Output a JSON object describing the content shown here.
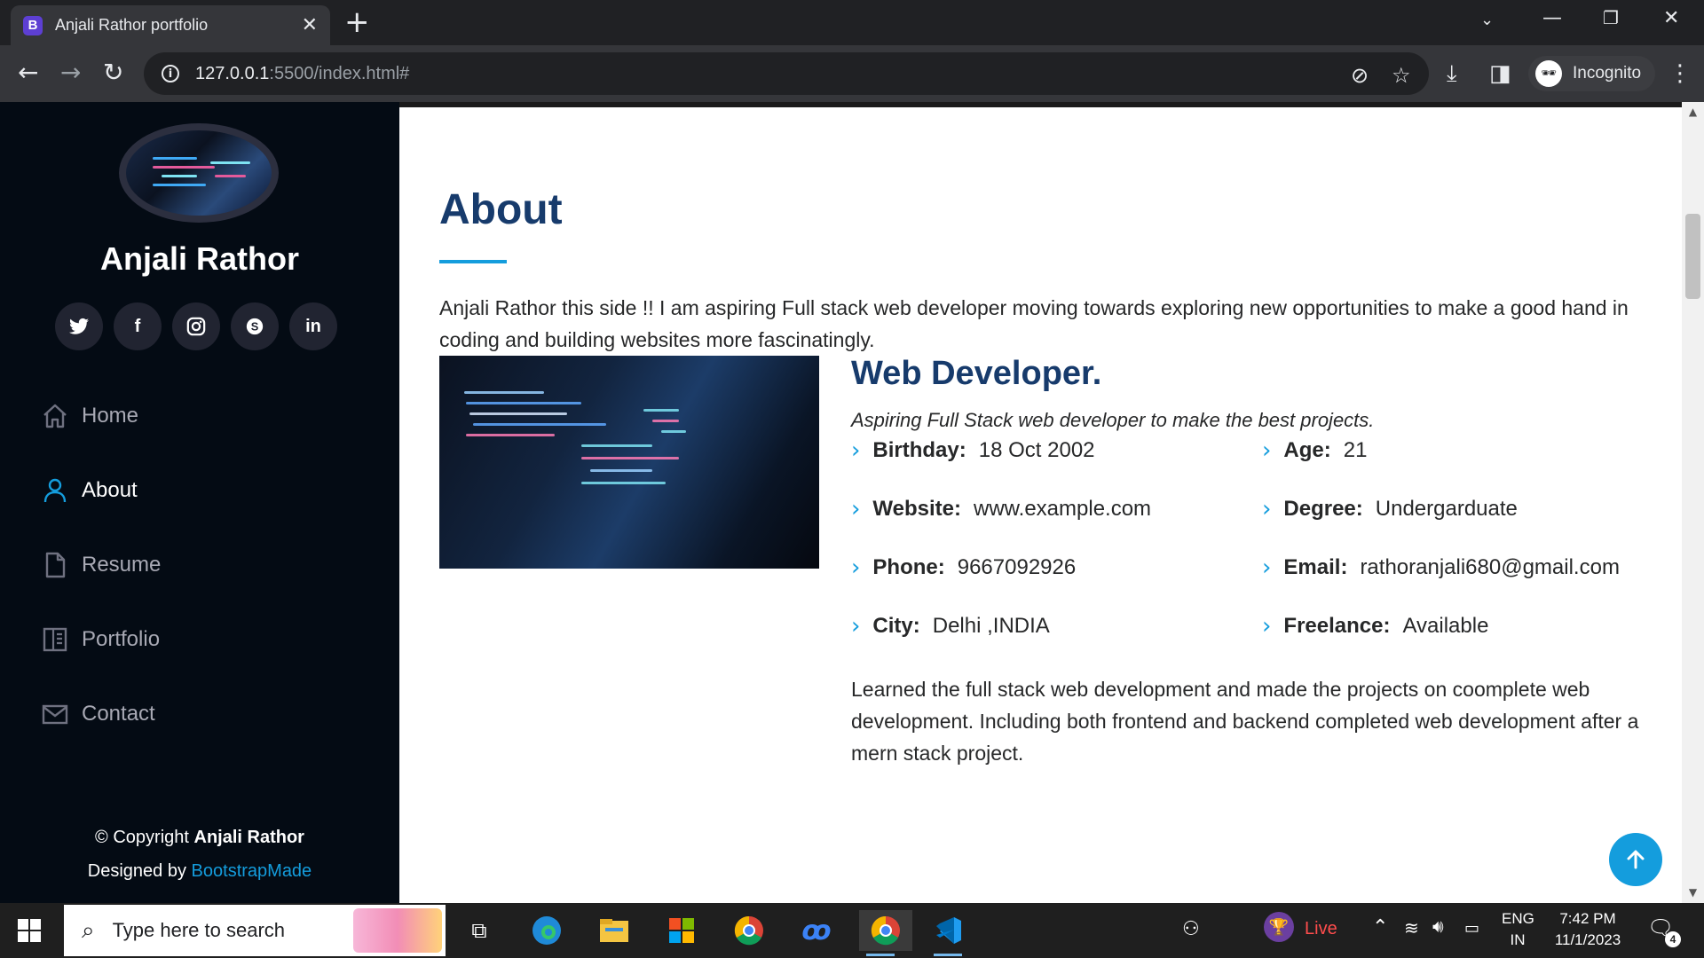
{
  "browser": {
    "tab_title": "Anjali Rathor portfolio",
    "favicon_letter": "B",
    "url_host": "127.0.0.1",
    "url_rest": ":5500/index.html#",
    "incognito_label": "Incognito"
  },
  "sidebar": {
    "name": "Anjali Rathor",
    "social": [
      {
        "icon": "twitter-icon",
        "glyph": "🐦"
      },
      {
        "icon": "facebook-icon",
        "glyph": "f"
      },
      {
        "icon": "instagram-icon",
        "glyph": "◎"
      },
      {
        "icon": "skype-icon",
        "glyph": "S"
      },
      {
        "icon": "linkedin-icon",
        "glyph": "in"
      }
    ],
    "nav": [
      {
        "label": "Home",
        "icon": "home-icon"
      },
      {
        "label": "About",
        "icon": "user-icon",
        "active": true
      },
      {
        "label": "Resume",
        "icon": "file-icon"
      },
      {
        "label": "Portfolio",
        "icon": "book-icon"
      },
      {
        "label": "Contact",
        "icon": "envelope-icon"
      }
    ],
    "footer": {
      "copyright_prefix": "© Copyright ",
      "copyright_name": "Anjali Rathor",
      "designed_prefix": "Designed by ",
      "designed_link": "BootstrapMade"
    }
  },
  "about": {
    "title": "About",
    "intro": "Anjali Rathor this side !! I am aspiring Full stack web developer moving towards exploring new opportunities to make a good hand in coding and building websites more fascinatingly.",
    "role": "Web Developer.",
    "tagline": "Aspiring Full Stack web developer to make the best projects.",
    "info_left": [
      {
        "label": "Birthday:",
        "value": "18 Oct 2002"
      },
      {
        "label": "Website:",
        "value": "www.example.com"
      },
      {
        "label": "Phone:",
        "value": "9667092926"
      },
      {
        "label": "City:",
        "value": "Delhi ,INDIA"
      }
    ],
    "info_right": [
      {
        "label": "Age:",
        "value": "21"
      },
      {
        "label": "Degree:",
        "value": "Undergarduate"
      },
      {
        "label": "Email:",
        "value": "rathoranjali680@gmail.com"
      },
      {
        "label": "Freelance:",
        "value": "Available"
      }
    ],
    "paragraph": "Learned the full stack web development and made the projects on coomplete web development. Including both frontend and backend completed web development after a mern stack project."
  },
  "taskbar": {
    "search_placeholder": "Type here to search",
    "live_label": "Live",
    "lang_top": "ENG",
    "lang_bottom": "IN",
    "time": "7:42 PM",
    "date": "11/1/2023",
    "notification_count": "4"
  },
  "colors": {
    "accent": "#149ddd",
    "heading": "#173b6c",
    "sidebar_bg": "#040b14"
  }
}
